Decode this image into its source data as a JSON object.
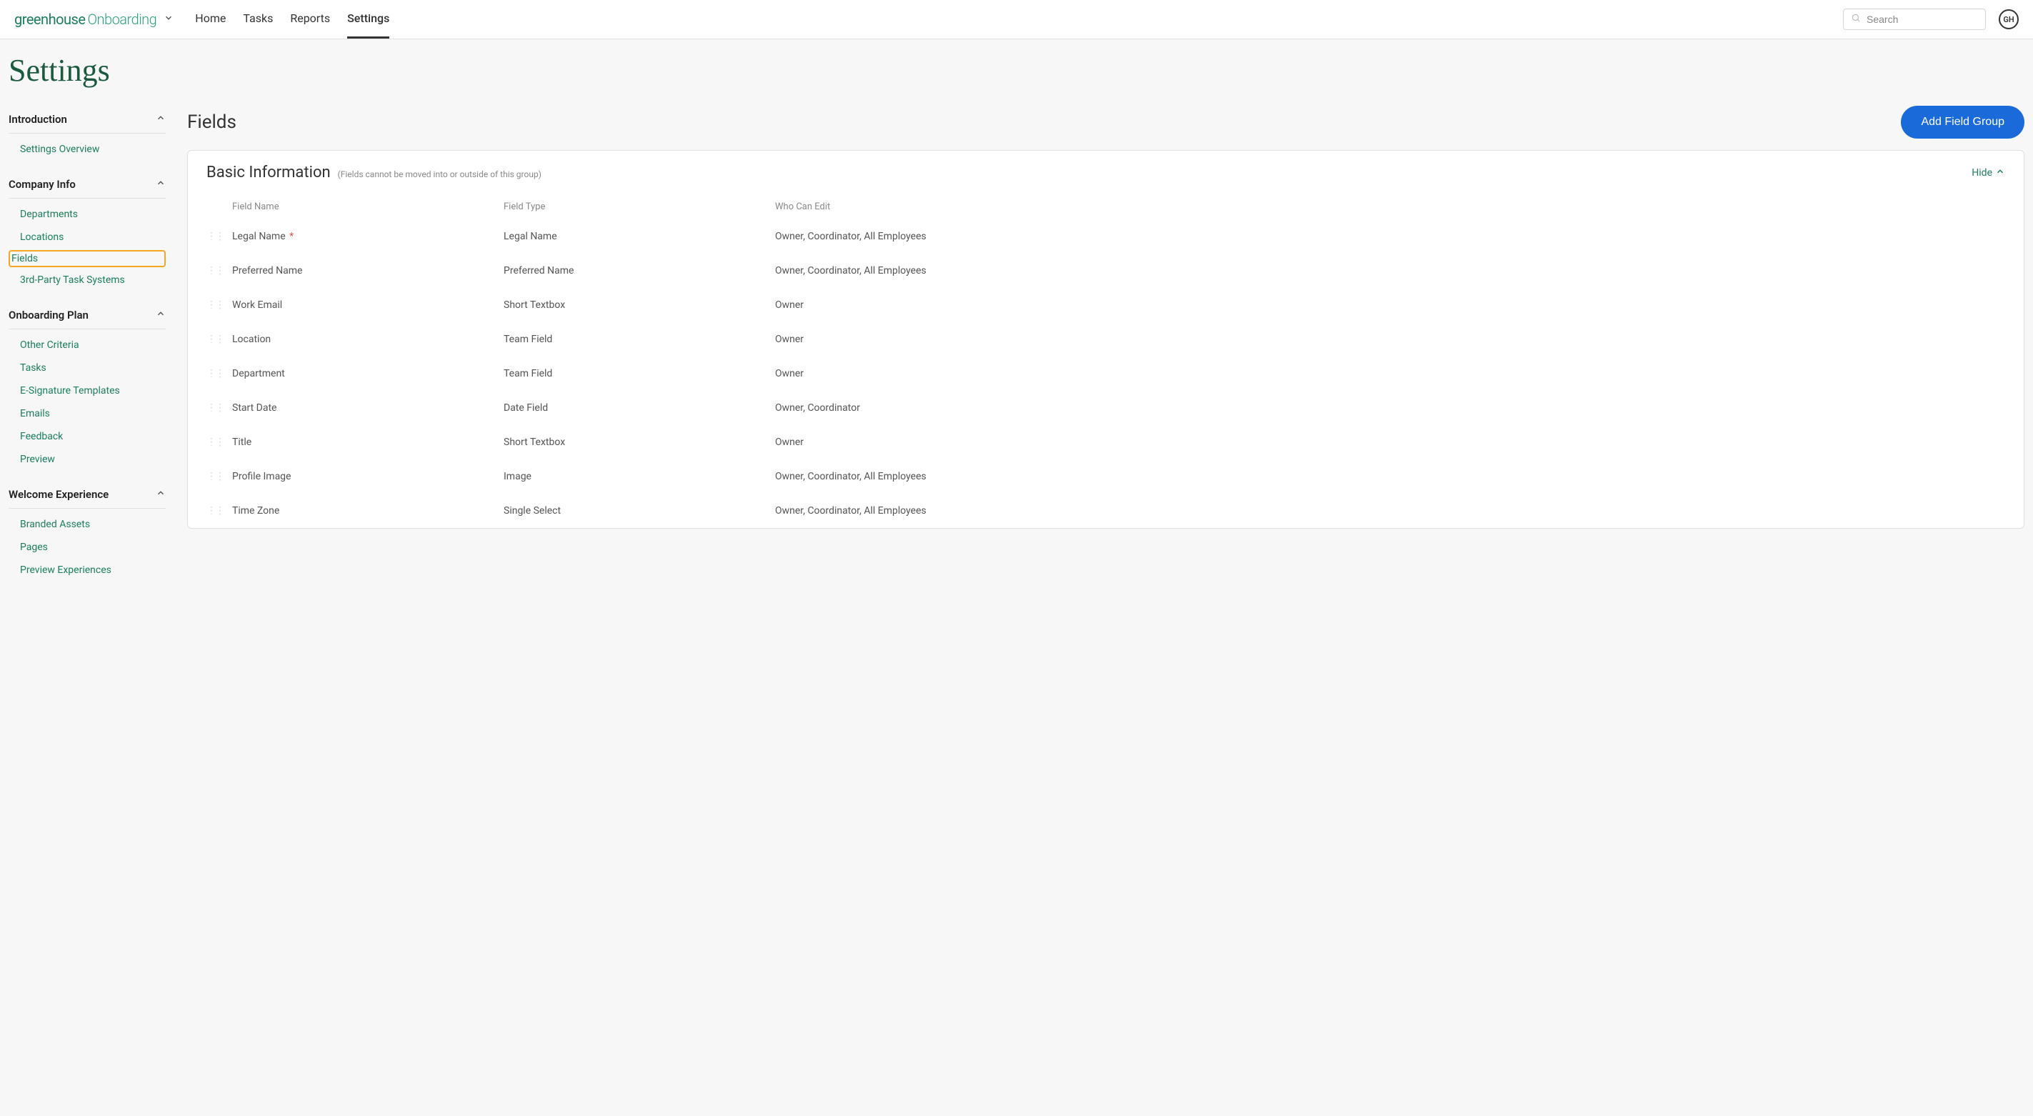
{
  "brand": {
    "part1": "greenhouse",
    "part2": "Onboarding"
  },
  "nav": {
    "items": [
      {
        "label": "Home"
      },
      {
        "label": "Tasks"
      },
      {
        "label": "Reports"
      },
      {
        "label": "Settings",
        "active": true
      }
    ]
  },
  "search": {
    "placeholder": "Search"
  },
  "avatar": {
    "initials": "GH"
  },
  "page": {
    "title": "Settings"
  },
  "sidebar": {
    "groups": [
      {
        "label": "Introduction",
        "items": [
          {
            "label": "Settings Overview"
          }
        ]
      },
      {
        "label": "Company Info",
        "items": [
          {
            "label": "Departments"
          },
          {
            "label": "Locations"
          },
          {
            "label": "Fields",
            "active": true
          },
          {
            "label": "3rd-Party Task Systems"
          }
        ]
      },
      {
        "label": "Onboarding Plan",
        "items": [
          {
            "label": "Other Criteria"
          },
          {
            "label": "Tasks"
          },
          {
            "label": "E-Signature Templates"
          },
          {
            "label": "Emails"
          },
          {
            "label": "Feedback"
          },
          {
            "label": "Preview"
          }
        ]
      },
      {
        "label": "Welcome Experience",
        "items": [
          {
            "label": "Branded Assets"
          },
          {
            "label": "Pages"
          },
          {
            "label": "Preview Experiences"
          }
        ]
      }
    ]
  },
  "main": {
    "title": "Fields",
    "add_button": "Add Field Group",
    "panel": {
      "title": "Basic Information",
      "note": "(Fields cannot be moved into or outside of this group)",
      "hide_label": "Hide",
      "columns": {
        "name": "Field Name",
        "type": "Field Type",
        "edit": "Who Can Edit"
      },
      "rows": [
        {
          "name": "Legal Name",
          "required": true,
          "type": "Legal Name",
          "edit": "Owner, Coordinator, All Employees"
        },
        {
          "name": "Preferred Name",
          "required": false,
          "type": "Preferred Name",
          "edit": "Owner, Coordinator, All Employees"
        },
        {
          "name": "Work Email",
          "required": false,
          "type": "Short Textbox",
          "edit": "Owner"
        },
        {
          "name": "Location",
          "required": false,
          "type": "Team Field",
          "edit": "Owner"
        },
        {
          "name": "Department",
          "required": false,
          "type": "Team Field",
          "edit": "Owner"
        },
        {
          "name": "Start Date",
          "required": false,
          "type": "Date Field",
          "edit": "Owner, Coordinator"
        },
        {
          "name": "Title",
          "required": false,
          "type": "Short Textbox",
          "edit": "Owner"
        },
        {
          "name": "Profile Image",
          "required": false,
          "type": "Image",
          "edit": "Owner, Coordinator, All Employees"
        },
        {
          "name": "Time Zone",
          "required": false,
          "type": "Single Select",
          "edit": "Owner, Coordinator, All Employees"
        }
      ]
    }
  }
}
